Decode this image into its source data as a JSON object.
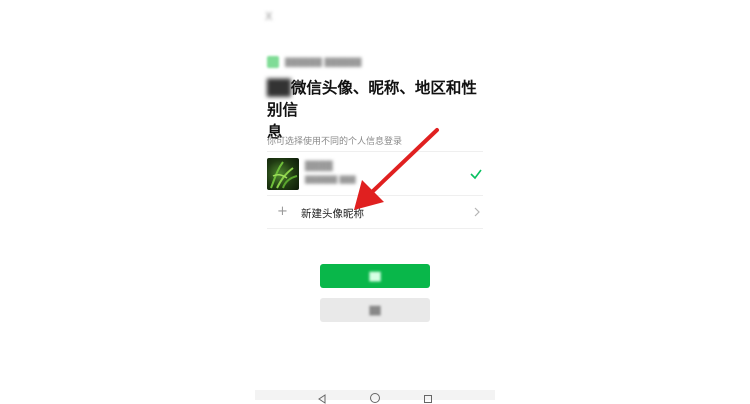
{
  "top_blurred_text": "X",
  "app": {
    "name_blurred": "██████ ██████",
    "icon_name": "app-icon"
  },
  "heading": {
    "blurred_prefix": "██",
    "text_part1": "微信头像、昵称、地区和性别信",
    "text_part2": "息"
  },
  "subtitle": "你可选择使用不同的个人信息登录",
  "profile": {
    "name_blurred": "████",
    "detail_blurred": "██████ ███",
    "check_icon": "check-icon",
    "check_color": "#07c160"
  },
  "new_profile": {
    "plus_icon": "plus-icon",
    "plus_glyph": "+",
    "label": "新建头像昵称",
    "chevron_icon": "chevron-right-icon"
  },
  "buttons": {
    "primary_label_blurred": "██",
    "primary_color": "#09b74a",
    "secondary_label_blurred": "██",
    "secondary_color": "#e9e9e9"
  },
  "annotation": {
    "arrow_color": "#e02020"
  },
  "nav": {
    "back_icon": "back-triangle-icon",
    "home_icon": "home-circle-icon",
    "recents_icon": "recents-square-icon"
  }
}
